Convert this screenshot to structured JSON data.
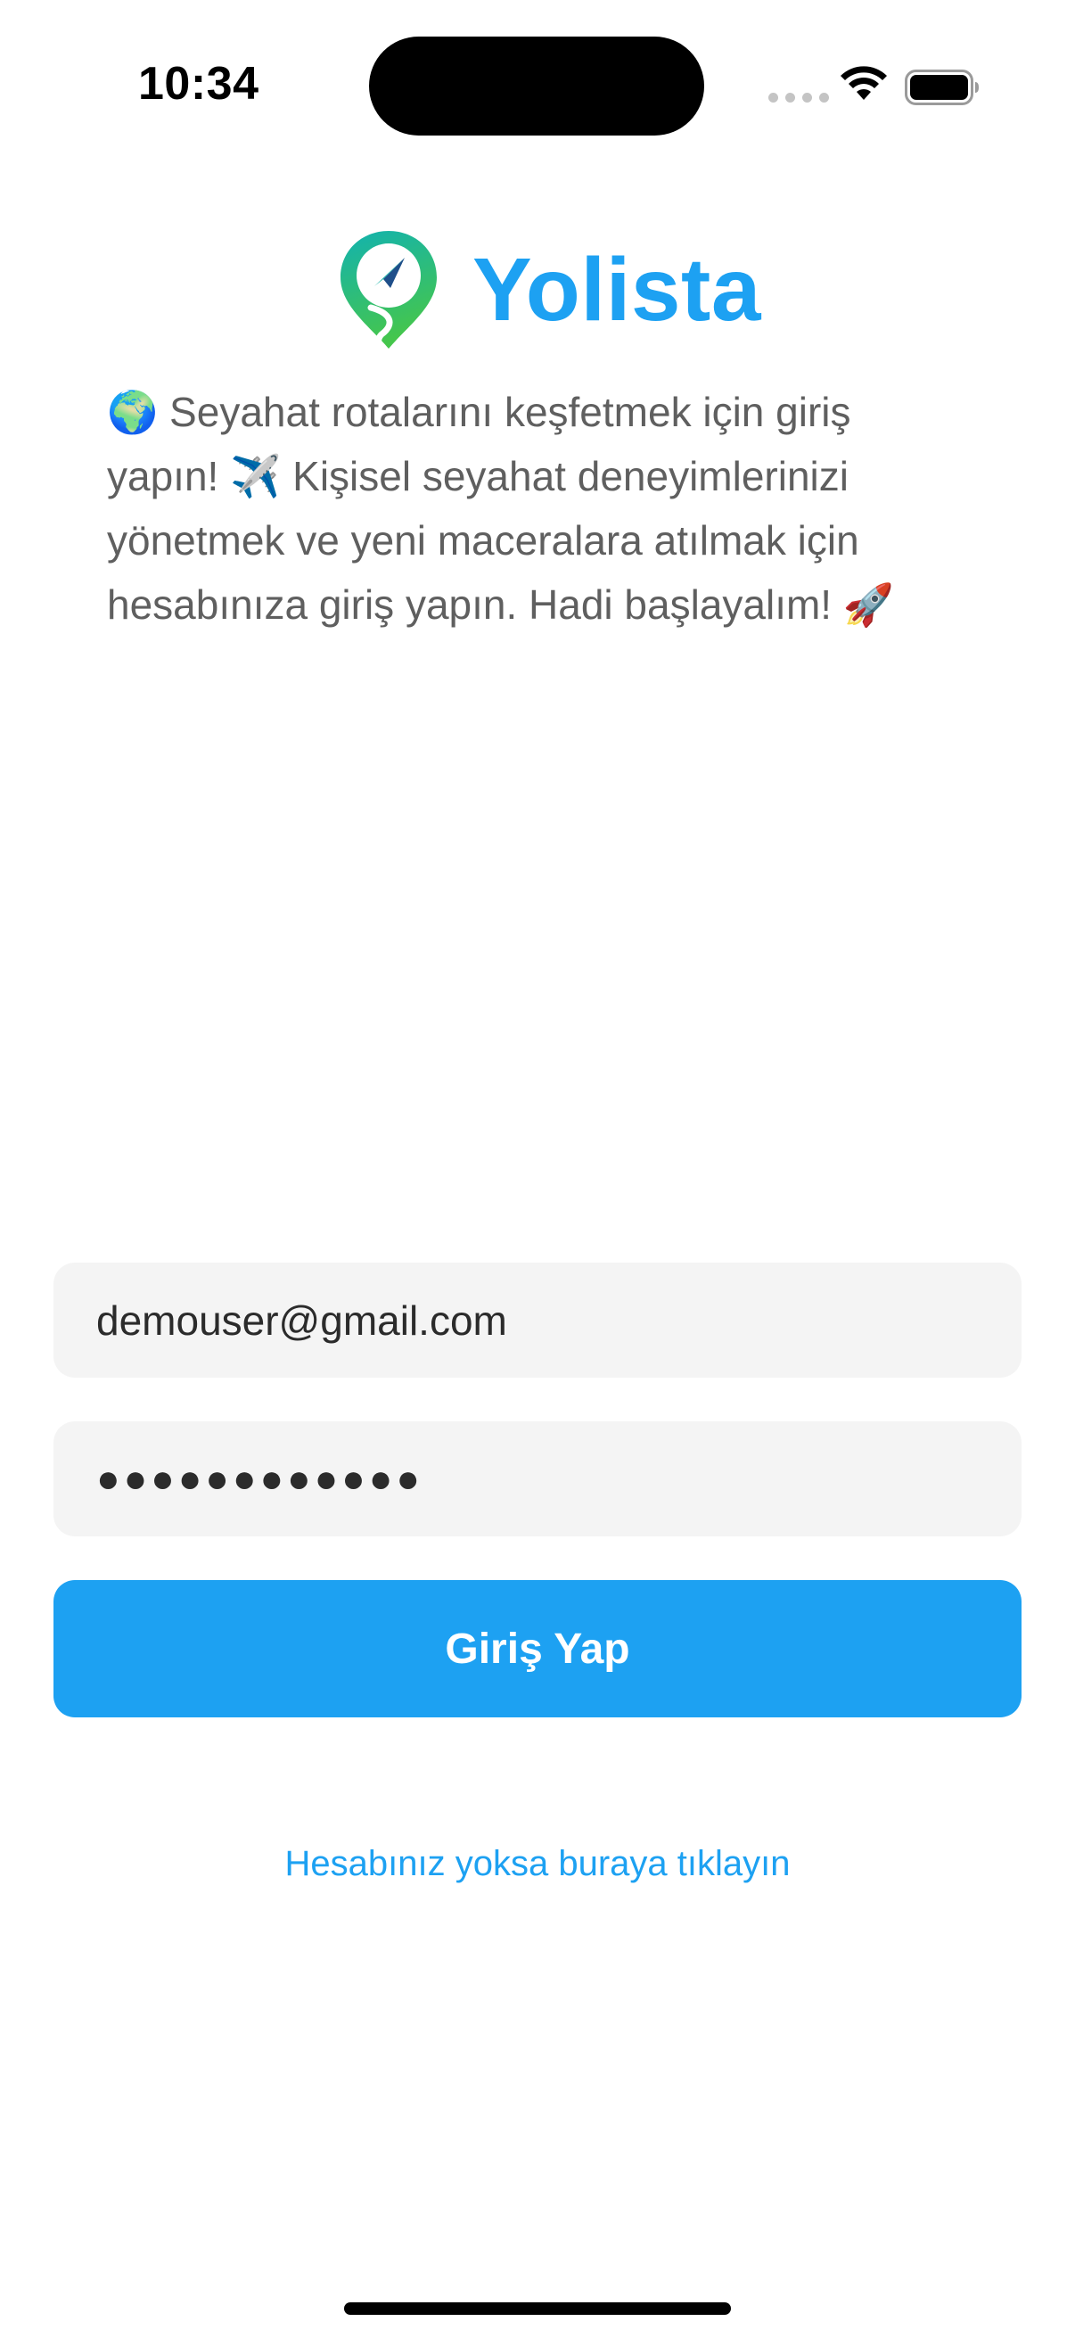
{
  "status_bar": {
    "time": "10:34"
  },
  "header": {
    "app_name": "Yolista",
    "logo_icon": "map-pin-compass-icon",
    "intro_text": "🌍 Seyahat rotalarını keşfetmek için giriş yapın! ✈️ Kişisel seyahat deneyimlerinizi yönetmek ve yeni maceralara atılmak için hesabınıza giriş yapın. Hadi başlayalım! 🚀"
  },
  "form": {
    "email_value": "demouser@gmail.com",
    "password_value": "●●●●●●●●●●●●",
    "login_label": "Giriş Yap",
    "signup_link": "Hesabınız yoksa buraya tıklayın"
  },
  "colors": {
    "accent": "#1da1f2",
    "field_bg": "#f4f4f4",
    "logo_teal": "#13b5a8",
    "logo_green": "#3cc45a"
  }
}
